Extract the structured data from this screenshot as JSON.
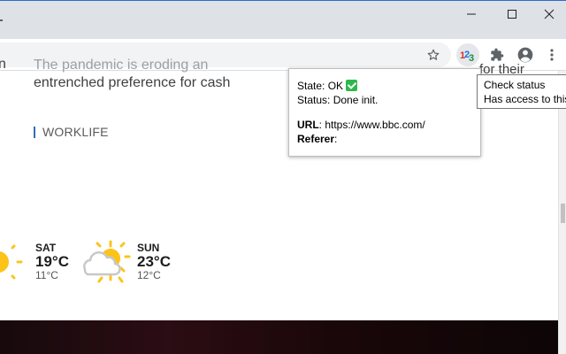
{
  "window": {
    "minimize_icon": "minimize-icon",
    "maximize_icon": "maximize-icon",
    "close_icon": "close-icon"
  },
  "toolbar": {
    "bookmark_icon": "star-icon",
    "active_extension_icon": "123-extension-icon",
    "extensions_icon": "puzzle-icon",
    "profile_icon": "account-circle-icon",
    "menu_icon": "kebab-menu-icon"
  },
  "page": {
    "left_fragment": "n",
    "headline_line1": "The pandemic is eroding an",
    "headline_line2": "entrenched preference for cash",
    "right_fragment": "for their",
    "tag": "WORKLIFE",
    "tag_color": "#2f6fb5",
    "weather": [
      {
        "day": "SAT",
        "high": "19°C",
        "low": "11°C",
        "icon": "sun-icon"
      },
      {
        "day": "SUN",
        "high": "23°C",
        "low": "12°C",
        "icon": "sun-behind-cloud-icon"
      }
    ]
  },
  "popup": {
    "state_label": "State: OK",
    "state_icon": "green-checkmark-icon",
    "status_label": "Status: Done init.",
    "url_label": "URL",
    "url_value": ": https://www.bbc.com/",
    "referer_label": "Referer",
    "referer_value": ":"
  },
  "tooltip": {
    "line1": "Check status",
    "line2": "Has access to this"
  }
}
